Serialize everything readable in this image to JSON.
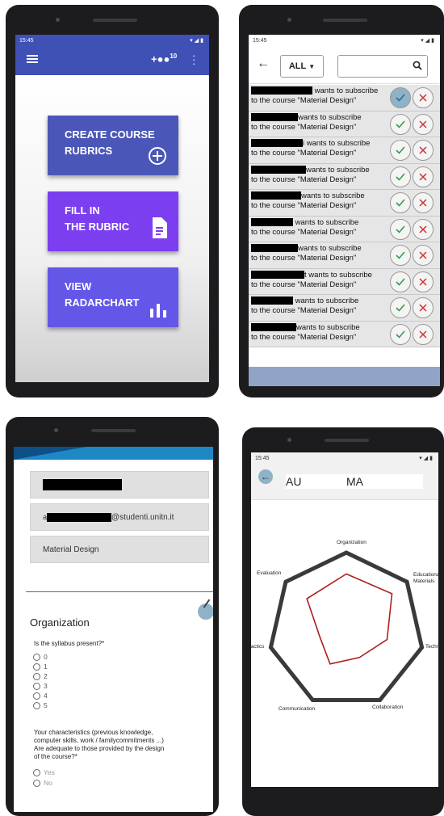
{
  "phone1": {
    "status_time": "15:45",
    "header": {
      "add_user_badge": "10"
    },
    "buttons": [
      {
        "label": "CREATE COURSE RUBRICS",
        "line1": "CREATE COURSE",
        "line2": "RUBRICS",
        "color": "#4b57b8",
        "icon": "add-circle-icon"
      },
      {
        "label": "FILL IN THE RUBRIC",
        "line1": "FILL IN",
        "line2": "THE RUBRIC",
        "color": "#7b3ff0",
        "icon": "document-icon"
      },
      {
        "label": "VIEW RADARCHART",
        "line1": "VIEW",
        "line2": "RADARCHART",
        "color": "#6457e8",
        "icon": "bar-chart-icon"
      }
    ]
  },
  "phone2": {
    "status_time": "15:45",
    "filter": "ALL",
    "requests": [
      {
        "line1": "wants to subscribe",
        "line2": "to the course \"Material Design\""
      },
      {
        "line1": "wants to subscribe",
        "line2": "to the course \"Material Design\""
      },
      {
        "line1": "i wants to subscribe",
        "line2": "to the course \"Material Design\""
      },
      {
        "line1": "wants to subscribe",
        "line2": "to the course \"Material Design\""
      },
      {
        "line1": "wants to subscribe",
        "line2": "to the course \"Material Design\""
      },
      {
        "line1": "wants to subscribe",
        "line2": "to the course \"Material Design\""
      },
      {
        "line1": "wants to subscribe",
        "line2": "to the course \"Material Design\""
      },
      {
        "line1": "t wants to subscribe",
        "line2": "to the course \"Material Design\""
      },
      {
        "line1": "wants to subscribe",
        "line2": "to the course \"Material Design\""
      },
      {
        "line1": "wants to subscribe",
        "line2": "to the course \"Material Design\""
      }
    ]
  },
  "phone3": {
    "email_suffix": "@studenti.unitn.it",
    "course": "Material Design",
    "section_title": "Organization",
    "question1": "Is the syllabus present?*",
    "options1": [
      "0",
      "1",
      "2",
      "3",
      "4",
      "5"
    ],
    "question2_lines": [
      "Your characteristics (previous knowledge,",
      "computer skills, work / familycommitments ...)",
      "Are adequate to those provided by the design",
      "of the course?*"
    ],
    "options2": [
      "Yes",
      "No"
    ]
  },
  "phone4": {
    "status_time": "15:45",
    "title_left": "AU",
    "title_right": "MA",
    "chart_data": {
      "type": "radar",
      "axes": [
        "Organization",
        "Educational Materials",
        "Technology",
        "Collaboration",
        "Communication",
        "Didactics",
        "Evaluation"
      ],
      "series": [
        {
          "values": [
            0.78,
            0.81,
            0.58,
            0.42,
            0.52,
            0.38,
            0.7
          ]
        }
      ],
      "range": [
        0,
        1
      ],
      "colors": {
        "outline": "#3a3a3a",
        "series": "#b01e1e"
      }
    }
  }
}
